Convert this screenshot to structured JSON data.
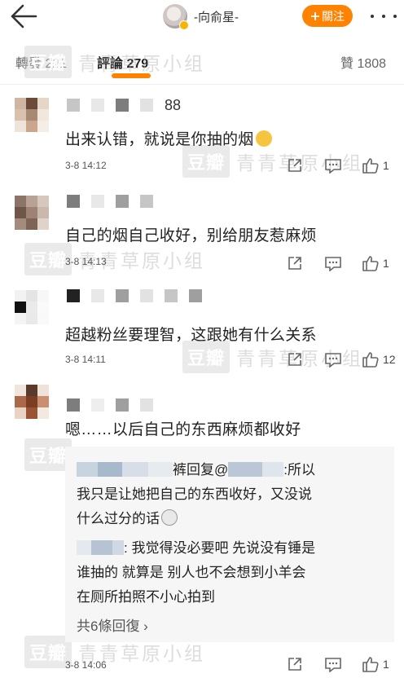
{
  "header": {
    "username": "-向俞星-",
    "follow_label": "關注"
  },
  "tabs": {
    "repost": "轉發 221",
    "comments": "評論 279",
    "likes": "贊 1808"
  },
  "watermark": {
    "logo": "豆瓣",
    "text": "青青草原小组"
  },
  "comments": [
    {
      "name_tail": "88",
      "text": "出来认错，就说是你抽的烟",
      "emoji": "doge-emoji",
      "time": "3-8 14:12",
      "likes": "1"
    },
    {
      "name_tail": "",
      "text": "自己的烟自己收好，别给朋友惹麻烦",
      "time": "3-8 14:13",
      "likes": "1"
    },
    {
      "name_tail": "",
      "text": "超越粉丝要理智，这跟她有什么关系",
      "time": "3-8 14:11",
      "likes": "12"
    },
    {
      "name_tail": "",
      "text": "嗯……以后自己的东西麻烦都收好",
      "time": "3-8 14:06",
      "likes": "1"
    }
  ],
  "replies": {
    "reply1_head": "裤回复@",
    "reply1_colon": ":所以",
    "reply1_line2": "我只是让她把自己的东西收好，又没说",
    "reply1_line3": "什么过分的话",
    "reply2_line1": ": 我觉得没必要吧 先说没有锤是",
    "reply2_line2": "谁抽的 就算是 别人也不会想到小羊会",
    "reply2_line3": "在厕所拍照不小心拍到",
    "more": "共6條回復 ›"
  },
  "colors": {
    "accent": "#ff8200",
    "icon": "#666666"
  }
}
